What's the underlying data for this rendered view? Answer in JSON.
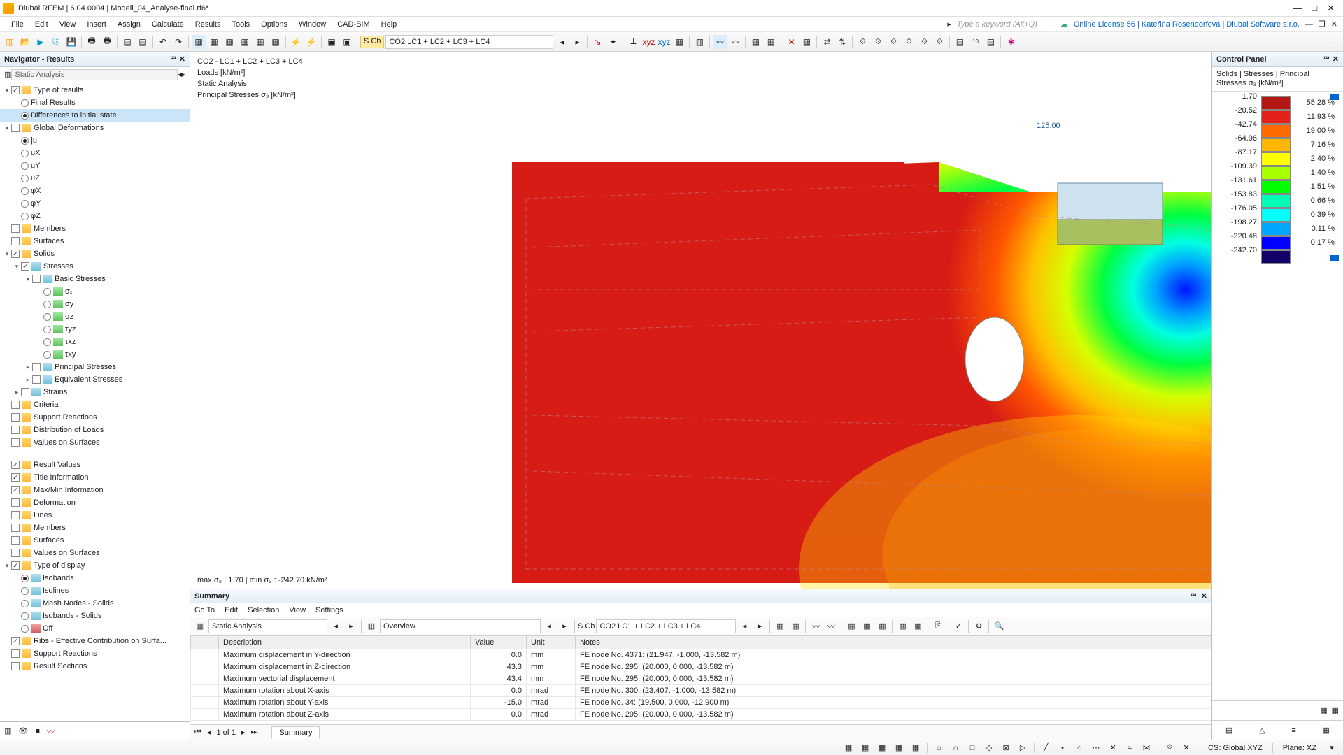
{
  "title": "Dlubal RFEM | 6.04.0004 | Modell_04_Analyse-final.rf6*",
  "menu": [
    "File",
    "Edit",
    "View",
    "Insert",
    "Assign",
    "Calculate",
    "Results",
    "Tools",
    "Options",
    "Window",
    "CAD-BIM",
    "Help"
  ],
  "kw_placeholder": "Type a keyword (Alt+Q)",
  "license": "Online License 56 | Kateřina Rosendorfová | Dlubal Software s.r.o.",
  "toolbar_combo": "CO2   LC1 + LC2 + LC3 + LC4",
  "sch": "S Ch",
  "nav": {
    "title": "Navigator - Results",
    "selector": "Static Analysis",
    "items": [
      {
        "t": "tog",
        "ind": 0,
        "cb": true,
        "ic": "f",
        "lbl": "Type of results"
      },
      {
        "t": "rb",
        "ind": 1,
        "on": false,
        "lbl": "Final Results"
      },
      {
        "t": "rb",
        "ind": 1,
        "on": true,
        "lbl": "Differences to initial state",
        "sel": true
      },
      {
        "t": "tog",
        "ind": 0,
        "cb": false,
        "ic": "f",
        "lbl": "Global Deformations"
      },
      {
        "t": "rb",
        "ind": 1,
        "on": true,
        "lbl": "|u|"
      },
      {
        "t": "rb",
        "ind": 1,
        "on": false,
        "lbl": "uX"
      },
      {
        "t": "rb",
        "ind": 1,
        "on": false,
        "lbl": "uY"
      },
      {
        "t": "rb",
        "ind": 1,
        "on": false,
        "lbl": "uZ"
      },
      {
        "t": "rb",
        "ind": 1,
        "on": false,
        "lbl": "φX"
      },
      {
        "t": "rb",
        "ind": 1,
        "on": false,
        "lbl": "φY"
      },
      {
        "t": "rb",
        "ind": 1,
        "on": false,
        "lbl": "φZ"
      },
      {
        "t": "leaf",
        "ind": 0,
        "cb": false,
        "ic": "f",
        "lbl": "Members"
      },
      {
        "t": "leaf",
        "ind": 0,
        "cb": false,
        "ic": "f",
        "lbl": "Surfaces"
      },
      {
        "t": "tog",
        "ind": 0,
        "cb": true,
        "ic": "f",
        "lbl": "Solids"
      },
      {
        "t": "tog",
        "ind": 1,
        "cb": true,
        "ic": "r",
        "lbl": "Stresses"
      },
      {
        "t": "tog",
        "ind": 2,
        "cb": false,
        "ic": "r",
        "lbl": "Basic Stresses"
      },
      {
        "t": "rb",
        "ind": 3,
        "on": false,
        "ic": "g",
        "lbl": "σₓ"
      },
      {
        "t": "rb",
        "ind": 3,
        "on": false,
        "ic": "g",
        "lbl": "σy"
      },
      {
        "t": "rb",
        "ind": 3,
        "on": false,
        "ic": "g",
        "lbl": "σz"
      },
      {
        "t": "rb",
        "ind": 3,
        "on": false,
        "ic": "g",
        "lbl": "τyz"
      },
      {
        "t": "rb",
        "ind": 3,
        "on": false,
        "ic": "g",
        "lbl": "τxz"
      },
      {
        "t": "rb",
        "ind": 3,
        "on": false,
        "ic": "g",
        "lbl": "τxy"
      },
      {
        "t": "leaf",
        "ind": 2,
        "cb": false,
        "ic": "r",
        "lbl": "Principal Stresses",
        "exp": ">"
      },
      {
        "t": "leaf",
        "ind": 2,
        "cb": false,
        "ic": "r",
        "lbl": "Equivalent Stresses",
        "exp": ">"
      },
      {
        "t": "leaf",
        "ind": 1,
        "cb": false,
        "ic": "r",
        "lbl": "Strains",
        "exp": ">"
      },
      {
        "t": "leaf",
        "ind": 0,
        "cb": false,
        "ic": "f",
        "lbl": "Criteria"
      },
      {
        "t": "leaf",
        "ind": 0,
        "cb": false,
        "ic": "f",
        "lbl": "Support Reactions"
      },
      {
        "t": "leaf",
        "ind": 0,
        "cb": false,
        "ic": "f",
        "lbl": "Distribution of Loads"
      },
      {
        "t": "leaf",
        "ind": 0,
        "cb": false,
        "ic": "f",
        "lbl": "Values on Surfaces"
      }
    ],
    "items2": [
      {
        "cb": true,
        "ic": "f",
        "lbl": "Result Values"
      },
      {
        "cb": true,
        "ic": "f",
        "lbl": "Title Information"
      },
      {
        "cb": true,
        "ic": "f",
        "lbl": "Max/Min Information"
      },
      {
        "cb": false,
        "ic": "f",
        "lbl": "Deformation"
      },
      {
        "cb": false,
        "ic": "f",
        "lbl": "Lines"
      },
      {
        "cb": false,
        "ic": "f",
        "lbl": "Members"
      },
      {
        "cb": false,
        "ic": "f",
        "lbl": "Surfaces"
      },
      {
        "cb": false,
        "ic": "f",
        "lbl": "Values on Surfaces"
      },
      {
        "cb": true,
        "ic": "f",
        "lbl": "Type of display",
        "tog": true
      },
      {
        "rb": true,
        "on": true,
        "ic": "r",
        "lbl": "Isobands"
      },
      {
        "rb": true,
        "on": false,
        "ic": "r",
        "lbl": "Isolines"
      },
      {
        "rb": true,
        "on": false,
        "ic": "r",
        "lbl": "Mesh Nodes - Solids"
      },
      {
        "rb": true,
        "on": false,
        "ic": "r",
        "lbl": "Isobands - Solids"
      },
      {
        "rb": true,
        "on": false,
        "ic": "x",
        "lbl": "Off"
      },
      {
        "cb": true,
        "ic": "f",
        "lbl": "Ribs - Effective Contribution on Surfa..."
      },
      {
        "cb": false,
        "ic": "f",
        "lbl": "Support Reactions"
      },
      {
        "cb": false,
        "ic": "f",
        "lbl": "Result Sections"
      }
    ]
  },
  "viewport": {
    "l1": "CO2 - LC1 + LC2 + LC3 + LC4",
    "l2": "Loads [kN/m²]",
    "l3": "Static Analysis",
    "l4": "Principal Stresses σ₃ [kN/m²]",
    "load": "125.00",
    "foot": "max σ₃ : 1.70 | min σ₃ : -242.70 kN/m²"
  },
  "summary": {
    "title": "Summary",
    "menu": [
      "Go To",
      "Edit",
      "Selection",
      "View",
      "Settings"
    ],
    "combo1": "Static Analysis",
    "combo2": "Overview",
    "combo3": "CO2   LC1 + LC2 + LC3 + LC4",
    "cols": [
      "",
      "Description",
      "Value",
      "Unit",
      "Notes"
    ],
    "rows": [
      [
        "",
        "Maximum displacement in Y-direction",
        "0.0",
        "mm",
        "FE node No. 4371: (21.947, -1.000, -13.582 m)"
      ],
      [
        "",
        "Maximum displacement in Z-direction",
        "43.3",
        "mm",
        "FE node No. 295: (20.000, 0.000, -13.582 m)"
      ],
      [
        "",
        "Maximum vectorial displacement",
        "43.4",
        "mm",
        "FE node No. 295: (20.000, 0.000, -13.582 m)"
      ],
      [
        "",
        "Maximum rotation about X-axis",
        "0.0",
        "mrad",
        "FE node No. 300: (23.407, -1.000, -13.582 m)"
      ],
      [
        "",
        "Maximum rotation about Y-axis",
        "-15.0",
        "mrad",
        "FE node No. 34: (19.500, 0.000, -12.900 m)"
      ],
      [
        "",
        "Maximum rotation about Z-axis",
        "0.0",
        "mrad",
        "FE node No. 295: (20.000, 0.000, -13.582 m)"
      ]
    ],
    "pager": "1 of 1",
    "tab": "Summary"
  },
  "cpanel": {
    "title": "Control Panel",
    "sub": "Solids | Stresses | Principal Stresses σ₃ [kN/m²]",
    "vals": [
      "1.70",
      "-20.52",
      "-42.74",
      "-64.96",
      "-87.17",
      "-109.39",
      "-131.61",
      "-153.83",
      "-176.05",
      "-198.27",
      "-220.48",
      "-242.70"
    ],
    "colors": [
      "#b31815",
      "#e52219",
      "#ff6a00",
      "#ffb600",
      "#ffff00",
      "#a7ff00",
      "#00ff00",
      "#00ffb6",
      "#00ffff",
      "#00a7ff",
      "#0000ff",
      "#120068"
    ],
    "pcts": [
      "55.28 %",
      "11.93 %",
      "19.00 %",
      "7.16 %",
      "2.40 %",
      "1.40 %",
      "1.51 %",
      "0.66 %",
      "0.39 %",
      "0.11 %",
      "0.17 %"
    ]
  },
  "status": {
    "cs": "CS: Global XYZ",
    "plane": "Plane: XZ"
  }
}
